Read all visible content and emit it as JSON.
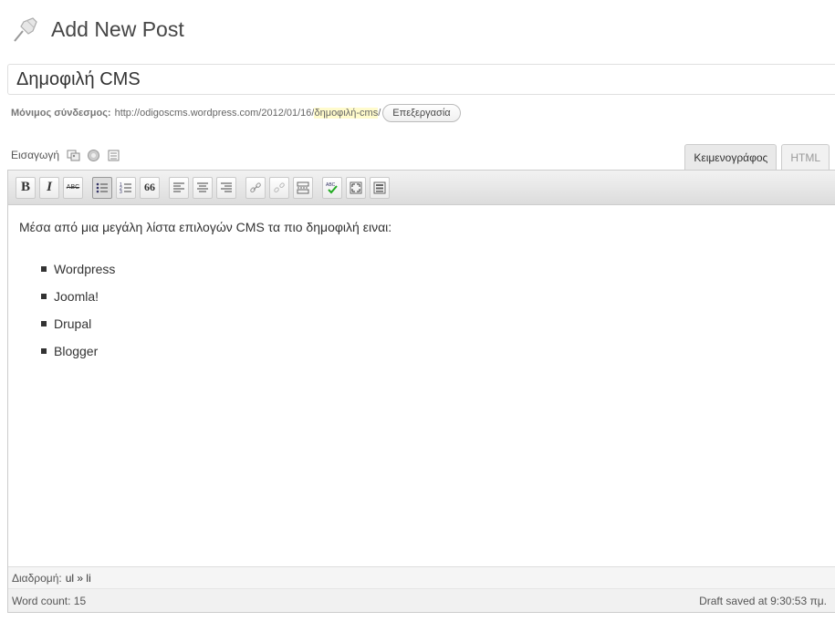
{
  "header": {
    "title": "Add New Post",
    "icon": "pushpin-icon"
  },
  "post": {
    "title_value": "Δημοφιλή CMS",
    "permalink_label": "Μόνιμος σύνδεσμος:",
    "permalink_url": "http://odigoscms.wordpress.com/2012/01/16/",
    "permalink_slug": "δημοφιλή-cms",
    "permalink_trailing": "/",
    "edit_button": "Επεξεργασία"
  },
  "media": {
    "insert_label": "Εισαγωγή",
    "icons": [
      "image-icon",
      "audio-icon",
      "media-icon"
    ]
  },
  "tabs": [
    {
      "label": "Κειμενογράφος",
      "active": true
    },
    {
      "label": "HTML",
      "active": false
    }
  ],
  "toolbar": {
    "bold": "B",
    "italic": "I",
    "strikethrough": "ABC",
    "blockquote": "66",
    "buttons": [
      "bold-icon",
      "italic-icon",
      "strikethrough-icon",
      "bullet-list-icon",
      "numbered-list-icon",
      "blockquote-icon",
      "align-left-icon",
      "align-center-icon",
      "align-right-icon",
      "link-icon",
      "unlink-icon",
      "more-tag-icon",
      "spellcheck-icon",
      "fullscreen-icon",
      "kitchen-sink-icon"
    ]
  },
  "content": {
    "intro": "Μέσα από μια μεγάλη λίστα επιλογών CMS τα πιο δημοφιλή ειναι:",
    "items": [
      "Wordpress",
      "Joomla!",
      "Drupal",
      "Blogger"
    ]
  },
  "path_bar": {
    "label": "Διαδρομή:",
    "value": "ul » li"
  },
  "status": {
    "word_count": "Word count: 15",
    "draft_saved": "Draft saved at 9:30:53 πμ."
  },
  "colors": {
    "slug_highlight": "#fffbcc",
    "toolbar_bg": "#dcdcdc"
  }
}
